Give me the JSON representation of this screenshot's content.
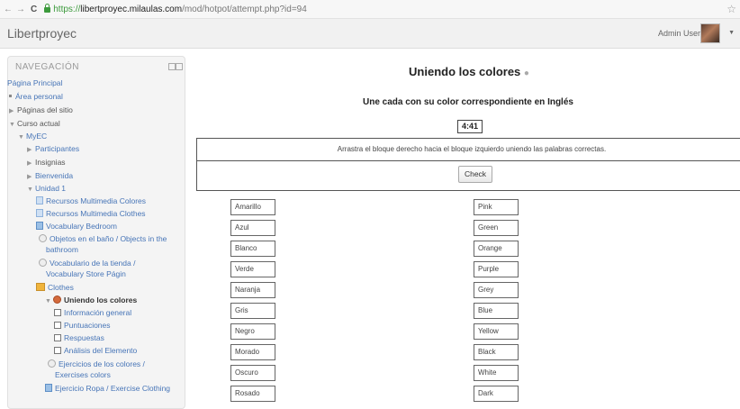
{
  "browser": {
    "url_scheme": "https://",
    "url_host": "libertproyec.milaulas.com",
    "url_path": "/mod/hotpot/attempt.php?id=94"
  },
  "header": {
    "site_name": "Libertproyec",
    "user_name": "Admin User"
  },
  "nav": {
    "title": "NAVEGACIÓN",
    "items": [
      {
        "label": "Página Principal"
      },
      {
        "label": "Área personal"
      },
      {
        "label": "Páginas del sitio"
      },
      {
        "label": "Curso actual"
      },
      {
        "label": "MyEC"
      },
      {
        "label": "Participantes"
      },
      {
        "label": "Insignias"
      },
      {
        "label": "Bienvenida"
      },
      {
        "label": "Unidad 1"
      },
      {
        "label": "Recursos Multimedia Colores"
      },
      {
        "label": "Recursos Multimedia Clothes"
      },
      {
        "label": "Vocabulary Bedroom"
      },
      {
        "label": "Objetos en el baño / Objects in the"
      },
      {
        "label": "bathroom"
      },
      {
        "label": "Vocabulario de la tienda /"
      },
      {
        "label": "Vocabulary Store Págin"
      },
      {
        "label": "Clothes"
      },
      {
        "label": "Uniendo los colores"
      },
      {
        "label": "Información general"
      },
      {
        "label": "Puntuaciones"
      },
      {
        "label": "Respuestas"
      },
      {
        "label": "Análisis del Elemento"
      },
      {
        "label": "Ejercicios de los colores /"
      },
      {
        "label": "Exercises colors"
      },
      {
        "label": "Ejercicio Ropa / Exercise Clothing"
      }
    ]
  },
  "main": {
    "title": "Uniendo los colores",
    "subtitle": "Une cada con su color correspondiente en Inglés",
    "timer": "4:41",
    "instructions": "Arrastra el bloque derecho hacia el bloque izquierdo uniendo las palabras correctas.",
    "check_label": "Check",
    "left_words": [
      "Amarillo",
      "Azul",
      "Blanco",
      "Verde",
      "Naranja",
      "Gris",
      "Negro",
      "Morado",
      "Oscuro",
      "Rosado"
    ],
    "right_words": [
      "Pink",
      "Green",
      "Orange",
      "Purple",
      "Grey",
      "Blue",
      "Yellow",
      "Black",
      "White",
      "Dark"
    ]
  }
}
